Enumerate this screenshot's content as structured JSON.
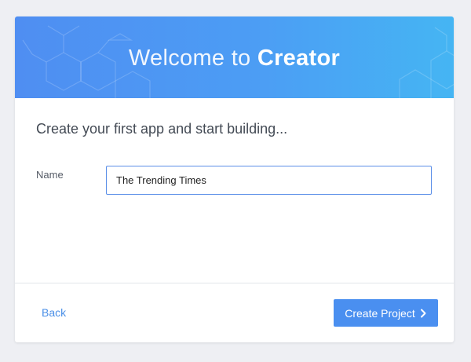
{
  "banner": {
    "title_prefix": "Welcome to",
    "title_brand": "Creator"
  },
  "main": {
    "subtitle": "Create your first app and start building..."
  },
  "form": {
    "name_label": "Name",
    "name_value": "The Trending Times"
  },
  "footer": {
    "back_label": "Back",
    "create_label": "Create Project",
    "create_icon": "chevron-right-icon"
  },
  "colors": {
    "banner_start": "#4f8ef2",
    "banner_end": "#45b5f3",
    "accent": "#4a8ff0",
    "link": "#4a8fe7",
    "page_bg": "#eeeff3"
  }
}
